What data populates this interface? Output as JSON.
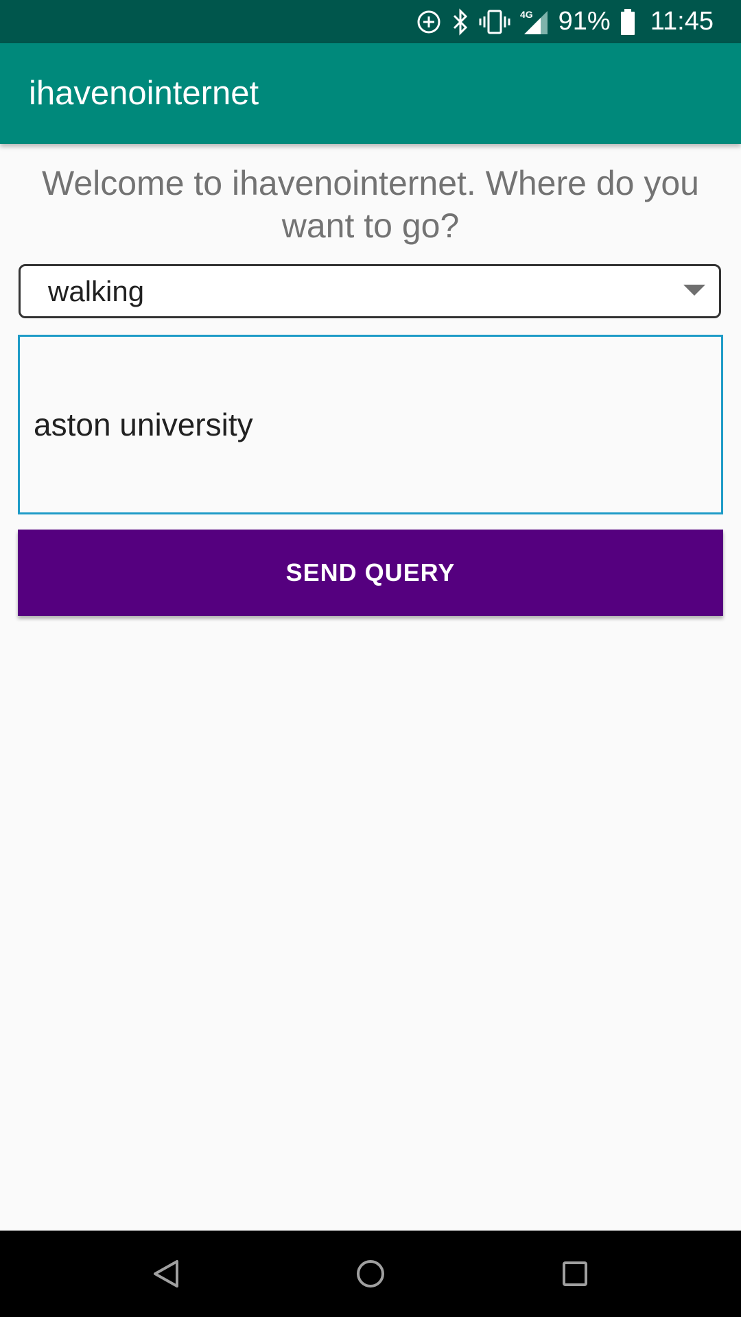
{
  "status_bar": {
    "battery": "91%",
    "time": "11:45",
    "network": "4G",
    "icons": [
      "data-saver-icon",
      "bluetooth-icon",
      "vibrate-icon",
      "signal-icon",
      "battery-icon"
    ]
  },
  "app_bar": {
    "title": "ihavenointernet"
  },
  "main": {
    "welcome": "Welcome to ihavenointernet. Where do you want to go?",
    "travel_mode": {
      "selected": "walking"
    },
    "destination": {
      "value": "aston university"
    },
    "send_button": "SEND QUERY"
  },
  "nav_bar": {
    "buttons": [
      "back-icon",
      "home-icon",
      "recents-icon"
    ]
  },
  "colors": {
    "status_bar": "#00564c",
    "app_bar": "#00897b",
    "button": "#55007f",
    "input_border": "#1e9bc7",
    "background": "#fafafa"
  }
}
